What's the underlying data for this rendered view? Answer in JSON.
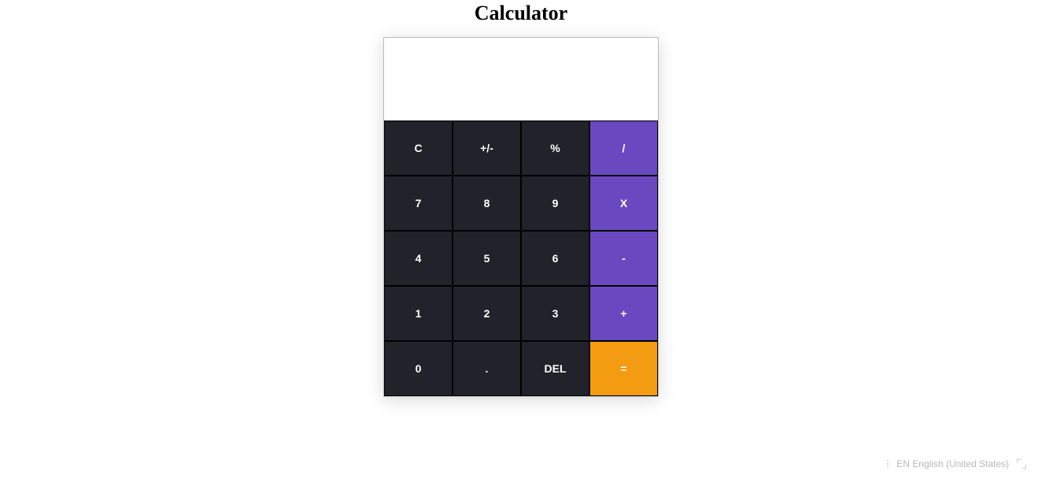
{
  "title": "Calculator",
  "display": "",
  "keys": {
    "clear": "C",
    "sign": "+/-",
    "percent": "%",
    "divide": "/",
    "seven": "7",
    "eight": "8",
    "nine": "9",
    "multiply": "X",
    "four": "4",
    "five": "5",
    "six": "6",
    "subtract": "-",
    "one": "1",
    "two": "2",
    "three": "3",
    "add": "+",
    "zero": "0",
    "decimal": ".",
    "delete": "DEL",
    "equals": "="
  },
  "language_indicator": "EN English (United States)"
}
